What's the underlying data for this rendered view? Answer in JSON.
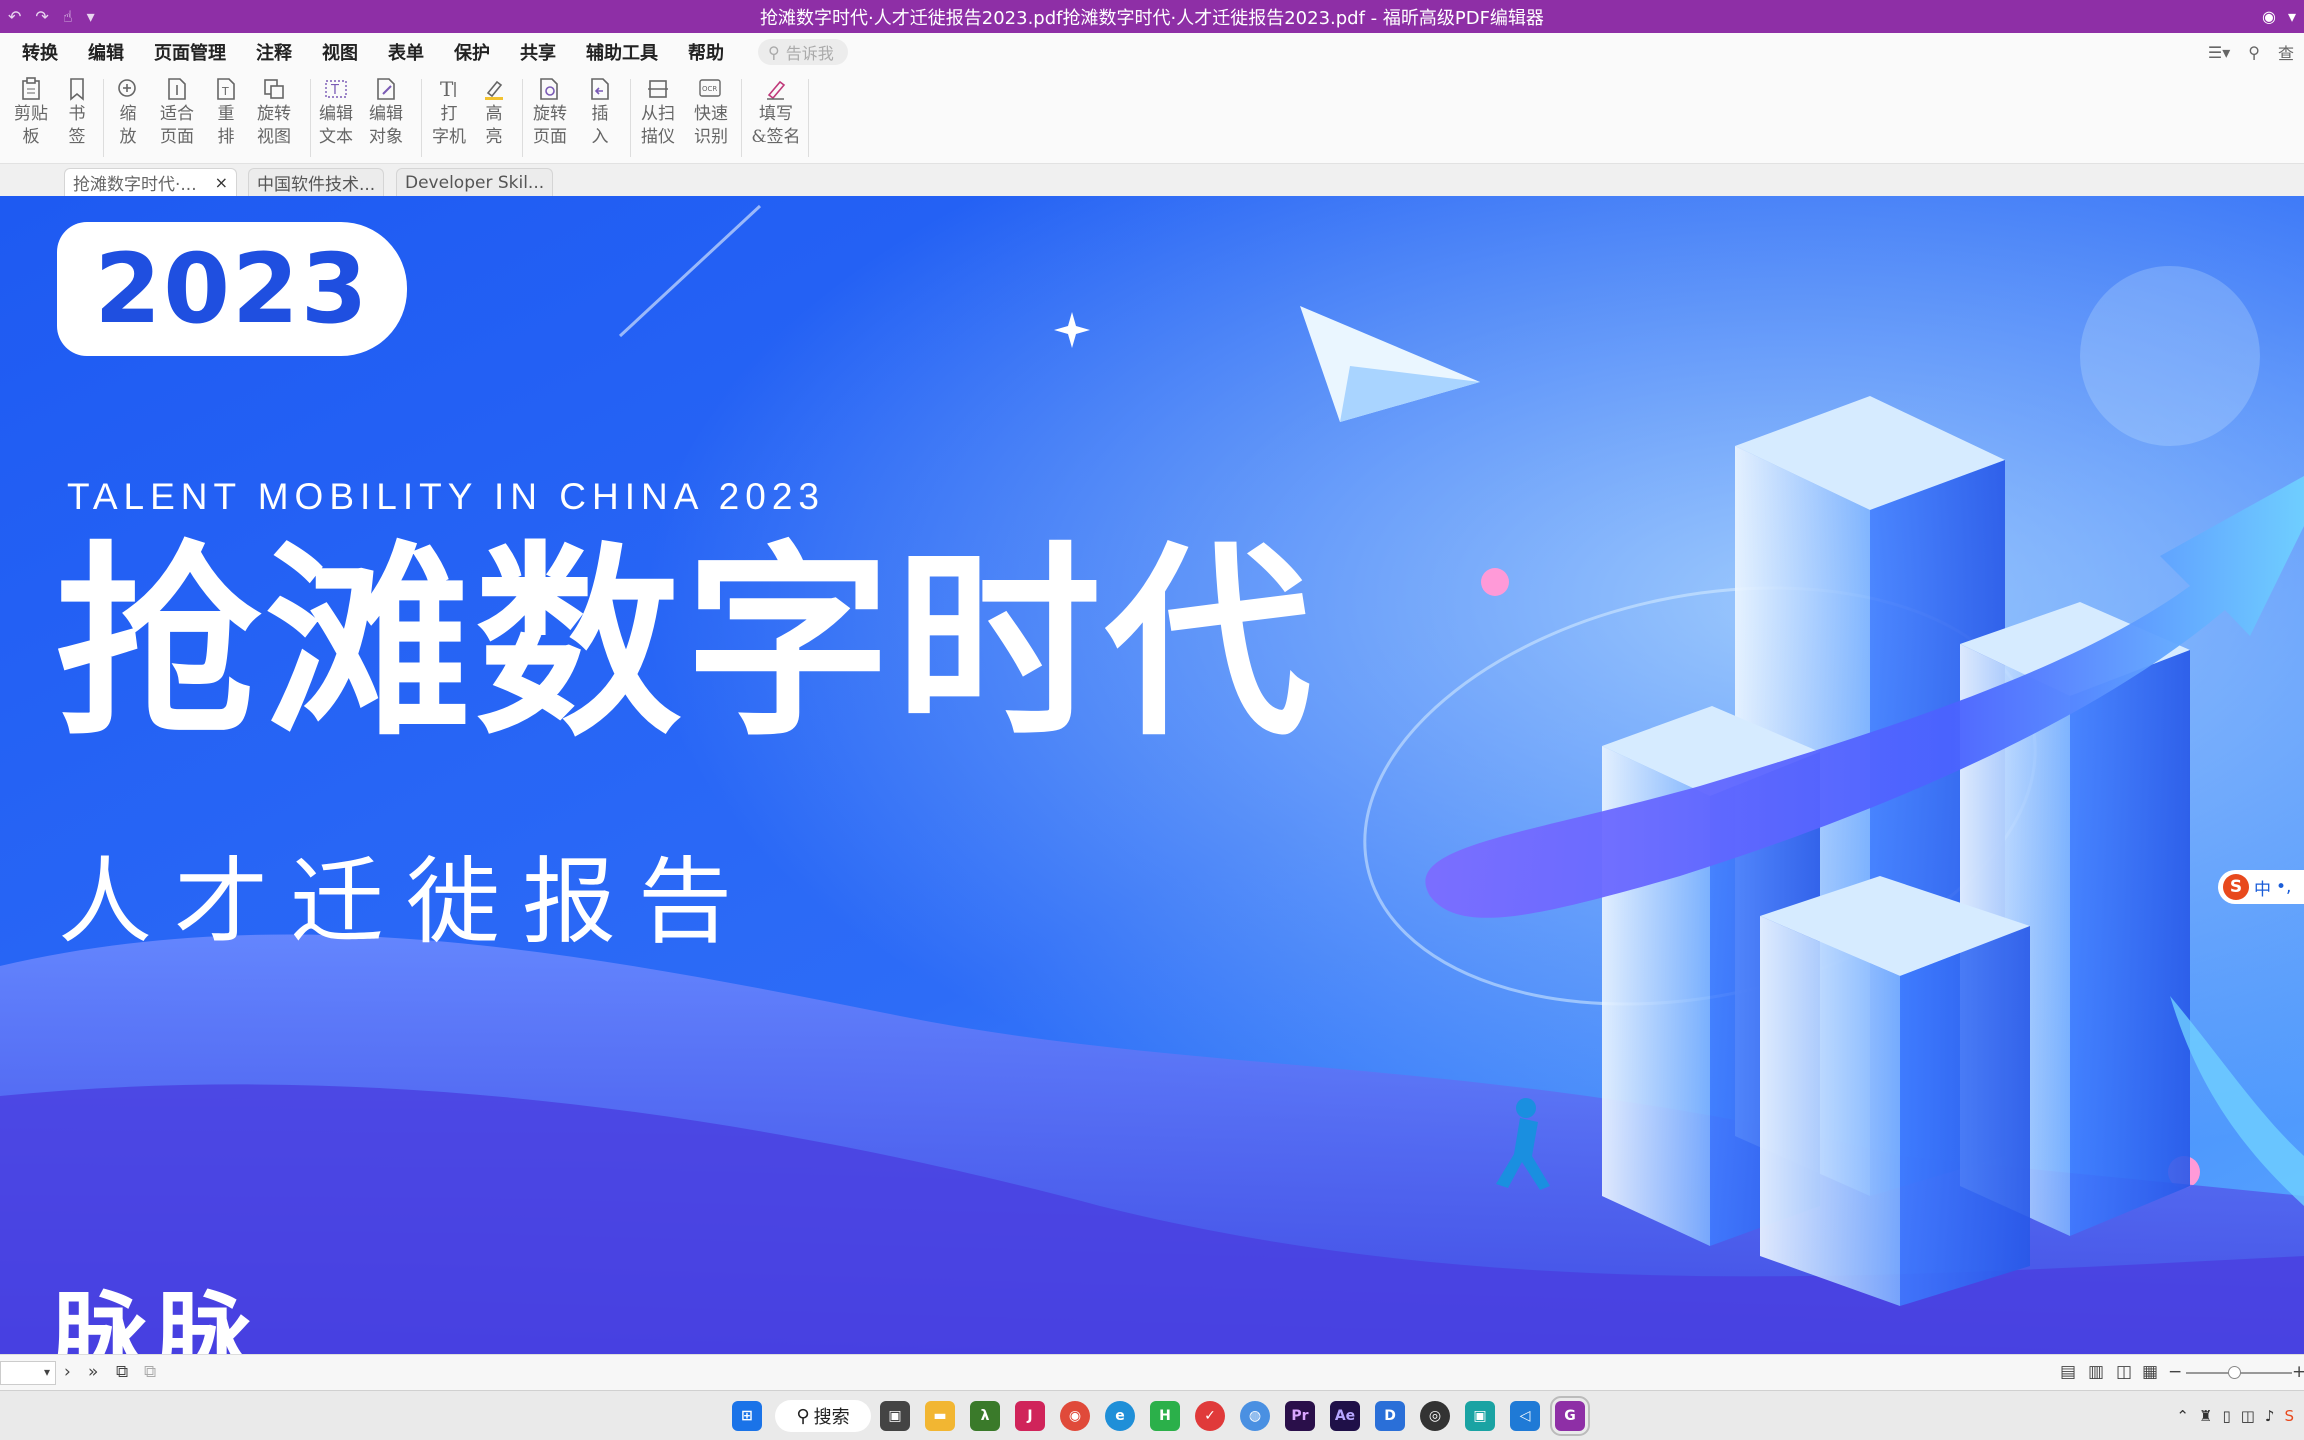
{
  "window": {
    "title": "抢滩数字时代·人才迁徙报告2023.pdf抢滩数字时代·人才迁徙报告2023.pdf - 福昕高级PDF编辑器"
  },
  "menu": {
    "items": [
      "转换",
      "编辑",
      "页面管理",
      "注释",
      "视图",
      "表单",
      "保护",
      "共享",
      "辅助工具",
      "帮助"
    ],
    "tell_me_placeholder": "告诉我",
    "search_label": "查"
  },
  "ribbon": {
    "buttons": [
      {
        "label": "剪贴\n板",
        "icon": "clipboard-icon"
      },
      {
        "label": "书\n签",
        "icon": "bookmark-icon"
      },
      {
        "label": "缩\n放",
        "icon": "zoom-icon"
      },
      {
        "label": "适合\n页面",
        "icon": "fit-page-icon"
      },
      {
        "label": "重\n排",
        "icon": "reflow-icon"
      },
      {
        "label": "旋转\n视图",
        "icon": "rotate-view-icon"
      },
      {
        "label": "编辑\n文本",
        "icon": "edit-text-icon"
      },
      {
        "label": "编辑\n对象",
        "icon": "edit-object-icon"
      },
      {
        "label": "打\n字机",
        "icon": "typewriter-icon"
      },
      {
        "label": "高\n亮",
        "icon": "highlight-icon"
      },
      {
        "label": "旋转\n页面",
        "icon": "rotate-page-icon"
      },
      {
        "label": "插\n入",
        "icon": "insert-icon"
      },
      {
        "label": "从扫\n描仪",
        "icon": "scanner-icon"
      },
      {
        "label": "快速\n识别",
        "icon": "ocr-icon"
      },
      {
        "label": "填写\n&签名",
        "icon": "fill-sign-icon"
      }
    ]
  },
  "tabs": [
    {
      "label": "抢滩数字时代·...",
      "active": true,
      "close": "×"
    },
    {
      "label": "中国软件技术...",
      "active": false
    },
    {
      "label": "Developer Skil...",
      "active": false
    }
  ],
  "document": {
    "year": "2023",
    "english_title": "TALENT MOBILITY IN CHINA 2023",
    "chinese_title": "抢滩数字时代",
    "subtitle": "人才迁徙报告",
    "brand": "脉脉",
    "colors": {
      "bg_top": "#1f54f0",
      "bg_bottom": "#3a4cf0",
      "accent": "#6fd0ff"
    }
  },
  "ime": {
    "logo": "S",
    "mode": "中",
    "punct": "•,"
  },
  "taskbar": {
    "search_label": "搜索",
    "apps": [
      {
        "name": "windows-start",
        "color": "#1a73e8",
        "glyph": "⊞"
      },
      {
        "name": "task-view",
        "color": "#444",
        "glyph": "▣"
      },
      {
        "name": "file-explorer",
        "color": "#f2b632",
        "glyph": "▬"
      },
      {
        "name": "lambda-app",
        "color": "#3a7a2a",
        "glyph": "λ"
      },
      {
        "name": "jetbrains",
        "color": "#d0245a",
        "glyph": "J"
      },
      {
        "name": "chrome",
        "color": "#e04a3a",
        "glyph": "◉"
      },
      {
        "name": "edge",
        "color": "#1f8fd8",
        "glyph": "e"
      },
      {
        "name": "hbuilder",
        "color": "#2bb04a",
        "glyph": "H"
      },
      {
        "name": "rss-app",
        "color": "#e03a3a",
        "glyph": "✓"
      },
      {
        "name": "photos",
        "color": "#4a90e2",
        "glyph": "◍"
      },
      {
        "name": "premiere",
        "color": "#2a0f4a",
        "glyph": "Pr"
      },
      {
        "name": "after-effects",
        "color": "#1f1048",
        "glyph": "Ae"
      },
      {
        "name": "dict-app",
        "color": "#2a6fd8",
        "glyph": "D"
      },
      {
        "name": "game-app",
        "color": "#333",
        "glyph": "◎"
      },
      {
        "name": "box-app",
        "color": "#1aa3a3",
        "glyph": "▣"
      },
      {
        "name": "vscode",
        "color": "#1f7ad6",
        "glyph": "◁"
      },
      {
        "name": "foxit-pdf",
        "color": "#8e2fa6",
        "glyph": "G"
      }
    ]
  }
}
